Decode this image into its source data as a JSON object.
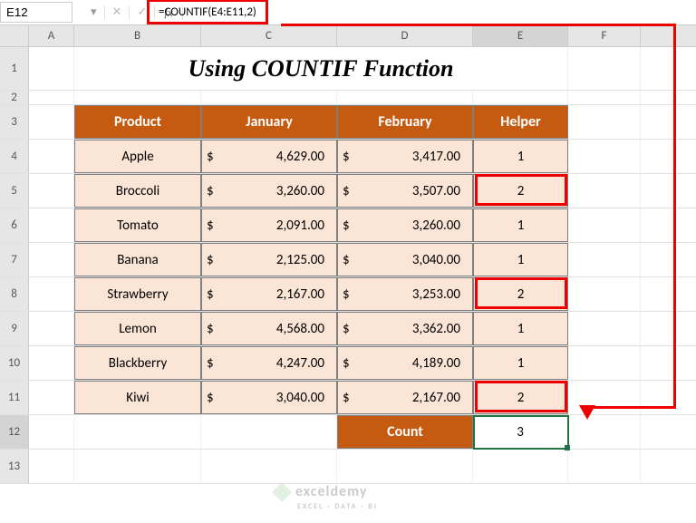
{
  "namebox": "E12",
  "formula": "=COUNTIF(E4:E11,2)",
  "fx": "fx",
  "title": "Using COUNTIF Function",
  "cols": {
    "A": "A",
    "B": "B",
    "C": "C",
    "D": "D",
    "E": "E",
    "F": "F"
  },
  "rows": {
    "r1": "1",
    "r2": "2",
    "r3": "3",
    "r4": "4",
    "r5": "5",
    "r6": "6",
    "r7": "7",
    "r8": "8",
    "r9": "9",
    "r10": "10",
    "r11": "11",
    "r12": "12",
    "r13": "13"
  },
  "headers": {
    "product": "Product",
    "jan": "January",
    "feb": "February",
    "helper": "Helper"
  },
  "data": [
    {
      "p": "Apple",
      "j": "4,629.00",
      "f": "3,417.00",
      "h": "1"
    },
    {
      "p": "Broccoli",
      "j": "3,260.00",
      "f": "3,507.00",
      "h": "2"
    },
    {
      "p": "Tomato",
      "j": "2,091.00",
      "f": "3,260.00",
      "h": "1"
    },
    {
      "p": "Banana",
      "j": "2,125.00",
      "f": "3,040.00",
      "h": "1"
    },
    {
      "p": "Strawberry",
      "j": "2,167.00",
      "f": "3,253.00",
      "h": "2"
    },
    {
      "p": "Lemon",
      "j": "4,568.00",
      "f": "3,362.00",
      "h": "1"
    },
    {
      "p": "Blackberry",
      "j": "4,247.00",
      "f": "4,189.00",
      "h": "1"
    },
    {
      "p": "Kiwi",
      "j": "3,040.00",
      "f": "2,167.00",
      "h": "2"
    }
  ],
  "dollar": "$",
  "countLabel": "Count",
  "countValue": "3",
  "wm": {
    "brand": "exceldemy",
    "tag": "EXCEL · DATA · BI"
  },
  "chart_data": {
    "type": "table",
    "title": "Using COUNTIF Function",
    "columns": [
      "Product",
      "January",
      "February",
      "Helper"
    ],
    "rows": [
      [
        "Apple",
        4629.0,
        3417.0,
        1
      ],
      [
        "Broccoli",
        3260.0,
        3507.0,
        2
      ],
      [
        "Tomato",
        2091.0,
        3260.0,
        1
      ],
      [
        "Banana",
        2125.0,
        3040.0,
        1
      ],
      [
        "Strawberry",
        2167.0,
        3253.0,
        2
      ],
      [
        "Lemon",
        4568.0,
        3362.0,
        1
      ],
      [
        "Blackberry",
        4247.0,
        4189.0,
        1
      ],
      [
        "Kiwi",
        3040.0,
        2167.0,
        2
      ]
    ],
    "summary": {
      "label": "Count",
      "value": 3,
      "formula": "=COUNTIF(E4:E11,2)"
    }
  }
}
